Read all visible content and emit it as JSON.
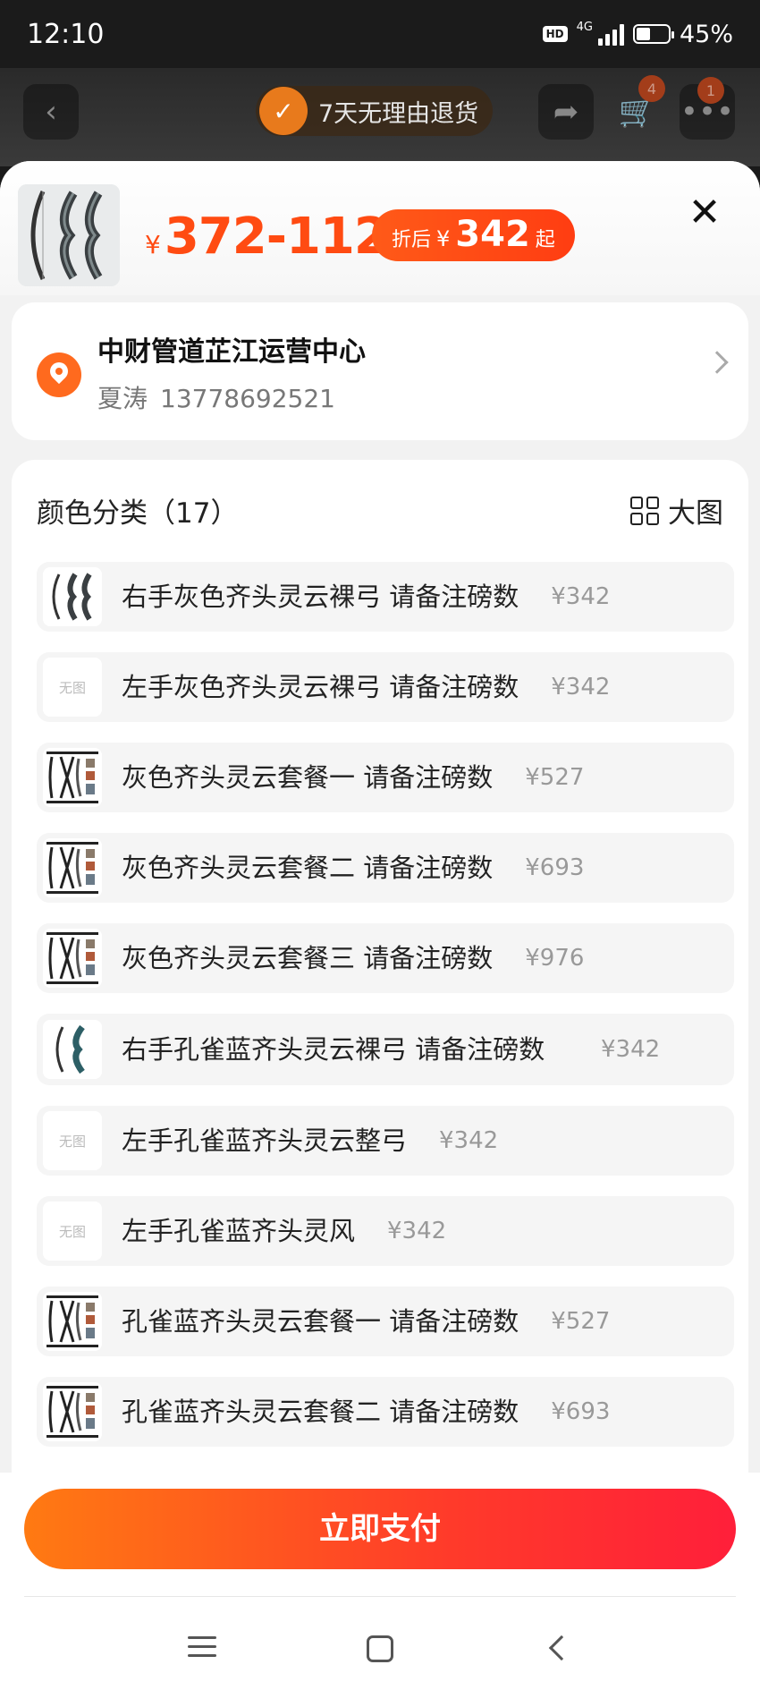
{
  "status_bar": {
    "time": "12:10",
    "hd": "HD",
    "network": "4G",
    "battery": "45%",
    "battery_level": 0.45
  },
  "background_nav": {
    "return_policy": "7天无理由退货",
    "cart_count": "4",
    "message_count": "1"
  },
  "header": {
    "currency": "¥",
    "price_range": "372-1126",
    "deal_prefix": "折后",
    "deal_currency": "¥",
    "deal_price": "342",
    "deal_suffix": "起"
  },
  "address": {
    "name": "中财管道芷江运营中心",
    "recipient": "夏涛",
    "phone": "13778692521"
  },
  "sku_section": {
    "title": "颜色分类（17）",
    "big_view_label": "大图",
    "no_image_label": "无图",
    "items": [
      {
        "name": "右手灰色齐头灵云裸弓 请备注磅数",
        "price": "¥342",
        "thumb": "bow"
      },
      {
        "name": "左手灰色齐头灵云裸弓 请备注磅数",
        "price": "¥342",
        "thumb": "none"
      },
      {
        "name": "灰色齐头灵云套餐一 请备注磅数",
        "price": "¥527",
        "thumb": "set"
      },
      {
        "name": "灰色齐头灵云套餐二 请备注磅数",
        "price": "¥693",
        "thumb": "set"
      },
      {
        "name": "灰色齐头灵云套餐三 请备注磅数",
        "price": "¥976",
        "thumb": "set"
      },
      {
        "name": "右手孔雀蓝齐头灵云裸弓 请备注磅数",
        "price": "¥342",
        "thumb": "bow-blue"
      },
      {
        "name": "左手孔雀蓝齐头灵云整弓",
        "price": "¥342",
        "thumb": "none"
      },
      {
        "name": "左手孔雀蓝齐头灵风",
        "price": "¥342",
        "thumb": "none"
      },
      {
        "name": "孔雀蓝齐头灵云套餐一 请备注磅数",
        "price": "¥527",
        "thumb": "set"
      },
      {
        "name": "孔雀蓝齐头灵云套餐二 请备注磅数",
        "price": "¥693",
        "thumb": "set"
      }
    ]
  },
  "footer": {
    "pay_button": "立即支付"
  },
  "colors": {
    "accent_orange": "#ff4b12",
    "pay_gradient_start": "#ff7a12",
    "pay_gradient_end": "#ff1f3a"
  }
}
